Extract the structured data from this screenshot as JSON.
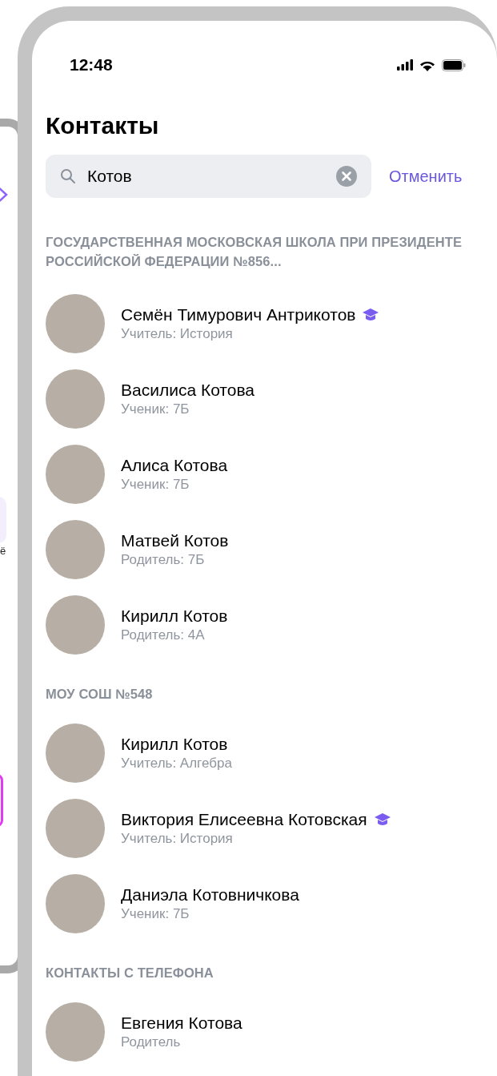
{
  "background_phone": {
    "fragment_text": "ё"
  },
  "status_bar": {
    "time": "12:48"
  },
  "title": "Контакты",
  "search": {
    "value": "Котов",
    "cancel": "Отменить"
  },
  "sections": [
    {
      "title": "ГОСУДАРСТВЕННАЯ МОСКОВСКАЯ ШКОЛА ПРИ ПРЕЗИДЕНТЕ РОССИЙСКОЙ ФЕДЕРАЦИИ №856...",
      "contacts": [
        {
          "name": "Семён Тимурович Антрикотов",
          "subtitle": "Учитель: История",
          "teacher_badge": true
        },
        {
          "name": "Василиса Котова",
          "subtitle": "Ученик: 7Б",
          "teacher_badge": false
        },
        {
          "name": "Алиса Котова",
          "subtitle": "Ученик: 7Б",
          "teacher_badge": false
        },
        {
          "name": "Матвей Котов",
          "subtitle": "Родитель: 7Б",
          "teacher_badge": false
        },
        {
          "name": "Кирилл Котов",
          "subtitle": "Родитель: 4А",
          "teacher_badge": false
        }
      ]
    },
    {
      "title": "МОУ СОШ №548",
      "contacts": [
        {
          "name": "Кирилл Котов",
          "subtitle": "Учитель: Алгебра",
          "teacher_badge": false
        },
        {
          "name": "Виктория Елисеевна Котовская",
          "subtitle": "Учитель: История",
          "teacher_badge": true
        },
        {
          "name": "Даниэла Котовничкова",
          "subtitle": "Ученик: 7Б",
          "teacher_badge": false
        }
      ]
    },
    {
      "title": "КОНТАКТЫ С ТЕЛЕФОНА",
      "contacts": [
        {
          "name": "Евгения Котова",
          "subtitle": "Родитель",
          "teacher_badge": false
        }
      ]
    }
  ]
}
